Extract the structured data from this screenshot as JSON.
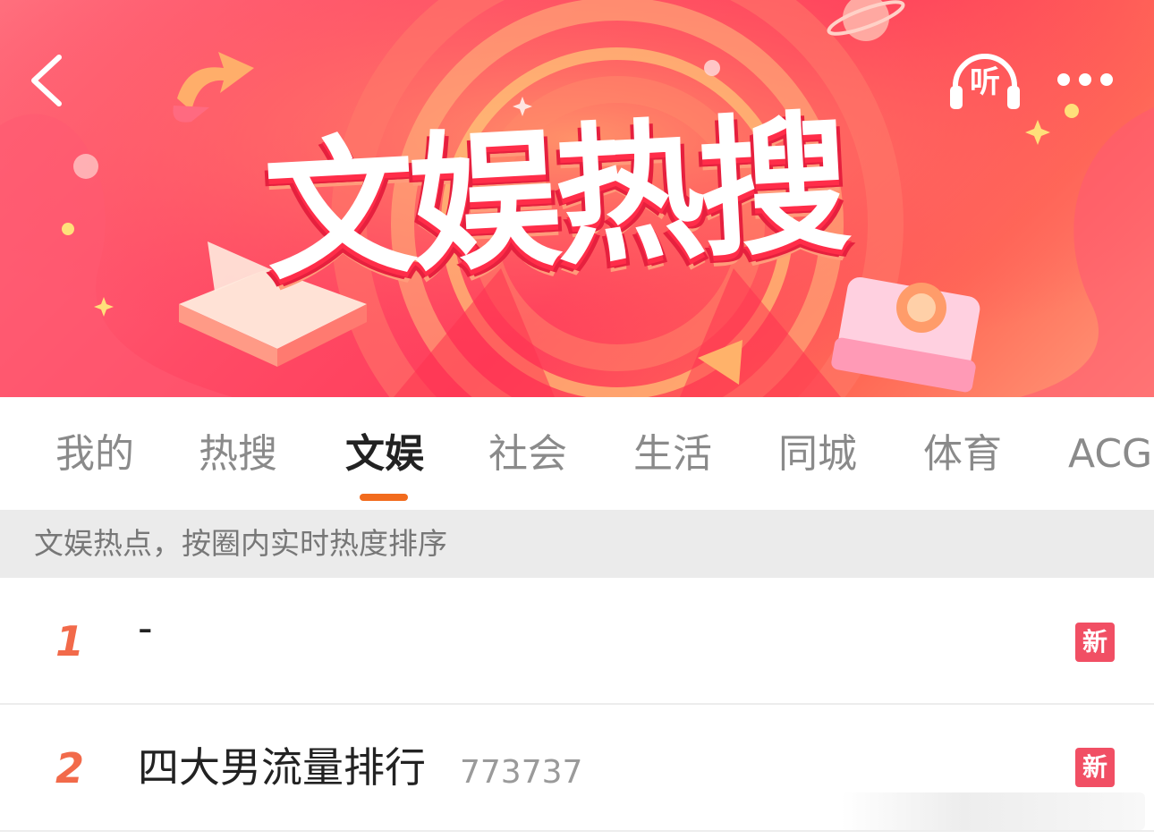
{
  "header": {
    "banner_title": "文娱热搜",
    "listen_label": "听",
    "back_icon": "chevron-left-icon",
    "more_icon": "more-dots-icon",
    "colors": {
      "banner_red": "#ff4b66",
      "accent_orange": "#f26b1d",
      "rank_color": "#f26a4a",
      "badge_red": "#f14f64"
    }
  },
  "tabs": [
    {
      "label": "我的",
      "active": false
    },
    {
      "label": "热搜",
      "active": false
    },
    {
      "label": "文娱",
      "active": true
    },
    {
      "label": "社会",
      "active": false
    },
    {
      "label": "生活",
      "active": false
    },
    {
      "label": "同城",
      "active": false
    },
    {
      "label": "体育",
      "active": false
    },
    {
      "label": "ACG",
      "active": false
    }
  ],
  "subheader": {
    "text": "文娱热点，按圈内实时热度排序"
  },
  "list": [
    {
      "rank": "1",
      "title": "-",
      "count": "",
      "badge": "新"
    },
    {
      "rank": "2",
      "title": "四大男流量排行",
      "count": "773737",
      "badge": "新"
    }
  ]
}
